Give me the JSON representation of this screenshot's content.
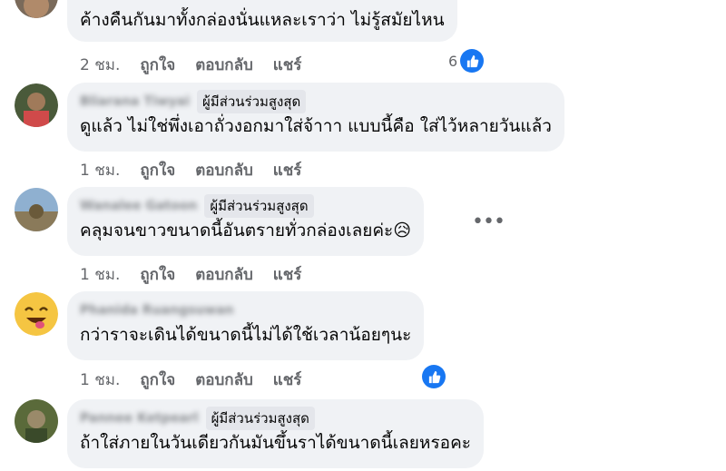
{
  "colors": {
    "like": "#1877f2",
    "bubble": "#f0f2f5",
    "meta": "#65676b"
  },
  "comments": [
    {
      "name": "",
      "badge": "",
      "text": "ค้างคืนกันมาทั้งกล่องนั่นแหละเราว่า ไม่รู้สมัยไหน",
      "time": "2 ชม.",
      "like_label": "ถูกใจ",
      "reply_label": "ตอบกลับ",
      "share_label": "แชร์",
      "reaction_count": "6"
    },
    {
      "name": "Bliarana Tiwyai",
      "badge": "ผู้มีส่วนร่วมสูงสุด",
      "text": "ดูแล้ว ไม่ใช่พึ่งเอาถั่วงอกมาใส่จ้าาา แบบนี้คือ ใส่ไว้หลายวันแล้ว",
      "time": "1 ชม.",
      "like_label": "ถูกใจ",
      "reply_label": "ตอบกลับ",
      "share_label": "แชร์"
    },
    {
      "name": "Wanalee Gatoon",
      "badge": "ผู้มีส่วนร่วมสูงสุด",
      "text": "คลุมจนขาวขนาดนี้อันตรายทั่วกล่องเลยค่ะ",
      "emoji": "😥",
      "time": "1 ชม.",
      "like_label": "ถูกใจ",
      "reply_label": "ตอบกลับ",
      "share_label": "แชร์",
      "more_label": "•••"
    },
    {
      "name": "Phanida Ruangsuwan",
      "badge": "",
      "text": "กว่าราจะเดินได้ขนาดนี้ไม่ได้ใช้เวลาน้อยๆนะ",
      "time": "1 ชม.",
      "like_label": "ถูกใจ",
      "reply_label": "ตอบกลับ",
      "share_label": "แชร์"
    },
    {
      "name": "Pannee Ketpearl",
      "badge": "ผู้มีส่วนร่วมสูงสุด",
      "text": "ถ้าใส่ภายในวันเดียวกันมันขึ้นราได้ขนาดนี้เลยหรอคะ"
    }
  ]
}
